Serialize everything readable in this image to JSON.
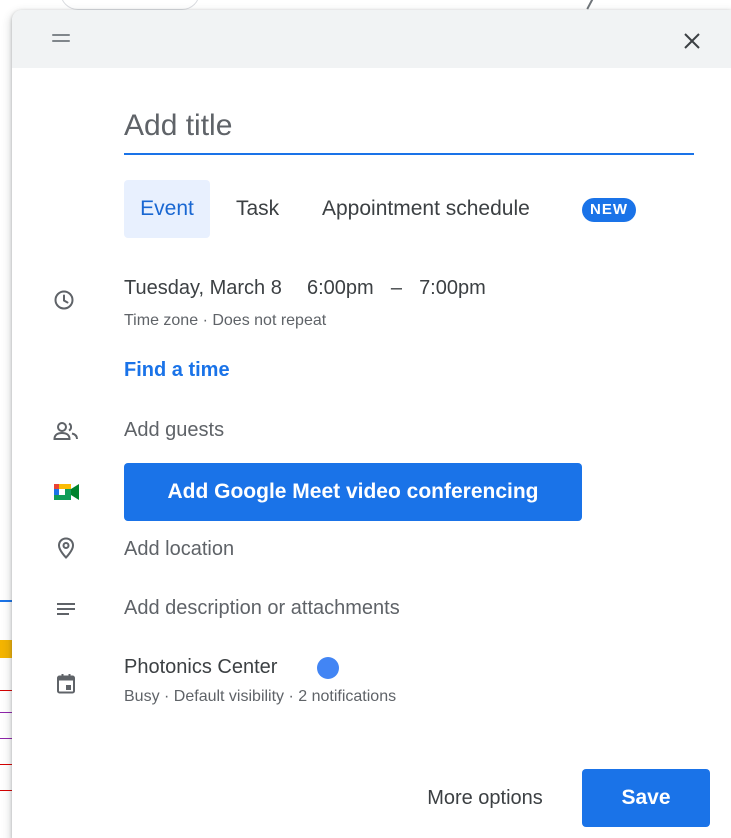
{
  "dialog": {
    "title_placeholder": "Add title"
  },
  "tabs": [
    {
      "label": "Event",
      "selected": true
    },
    {
      "label": "Task",
      "selected": false
    },
    {
      "label": "Appointment schedule",
      "selected": false,
      "badge": "NEW"
    }
  ],
  "datetime": {
    "date": "Tuesday, March 8",
    "start": "6:00pm",
    "separator": "–",
    "end": "7:00pm",
    "timezone_link": "Time zone",
    "dot": "·",
    "repeat": "Does not repeat",
    "find_time": "Find a time"
  },
  "guests": {
    "label": "Add guests"
  },
  "meet": {
    "label": "Add Google Meet video conferencing"
  },
  "location": {
    "label": "Add location"
  },
  "description": {
    "label": "Add description or attachments"
  },
  "calendar": {
    "name": "Photonics Center",
    "color": "#4285f4",
    "details": "Busy · Default visibility · 2 notifications"
  },
  "footer": {
    "more_options": "More options",
    "save": "Save"
  },
  "colors": {
    "accent": "#1a73e8",
    "header_bg": "#f1f3f4",
    "tab_selected_bg": "#e8f0fe"
  },
  "icons": [
    "drag-handle-icon",
    "close-icon",
    "clock-icon",
    "people-icon",
    "google-meet-icon",
    "location-pin-icon",
    "notes-icon",
    "calendar-icon"
  ]
}
